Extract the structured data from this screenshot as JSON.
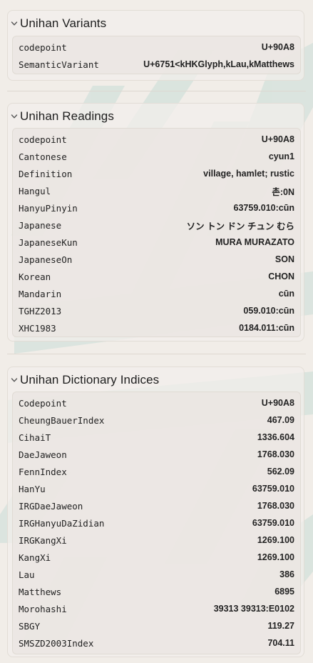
{
  "variants": {
    "title": "Unihan Variants",
    "rows": [
      {
        "key": "codepoint",
        "value": "U+90A8"
      },
      {
        "key": "SemanticVariant",
        "value": "U+6751<kHKGlyph,kLau,kMatthews"
      }
    ]
  },
  "readings": {
    "title": "Unihan Readings",
    "rows": [
      {
        "key": "codepoint",
        "value": "U+90A8"
      },
      {
        "key": "Cantonese",
        "value": "cyun1"
      },
      {
        "key": "Definition",
        "value": "village, hamlet; rustic"
      },
      {
        "key": "Hangul",
        "value": "촌:0N"
      },
      {
        "key": "HanyuPinyin",
        "value": "63759.010:cūn"
      },
      {
        "key": "Japanese",
        "value": "ソン トン ドン チュン むら"
      },
      {
        "key": "JapaneseKun",
        "value": "MURA MURAZATO"
      },
      {
        "key": "JapaneseOn",
        "value": "SON"
      },
      {
        "key": "Korean",
        "value": "CHON"
      },
      {
        "key": "Mandarin",
        "value": "cūn"
      },
      {
        "key": "TGHZ2013",
        "value": "059.010:cūn"
      },
      {
        "key": "XHC1983",
        "value": "0184.011:cūn"
      }
    ]
  },
  "indices": {
    "title": "Unihan Dictionary Indices",
    "rows": [
      {
        "key": "Codepoint",
        "value": "U+90A8"
      },
      {
        "key": "CheungBauerIndex",
        "value": "467.09"
      },
      {
        "key": "CihaiT",
        "value": "1336.604"
      },
      {
        "key": "DaeJaweon",
        "value": "1768.030"
      },
      {
        "key": "FennIndex",
        "value": "562.09"
      },
      {
        "key": "HanYu",
        "value": "63759.010"
      },
      {
        "key": "IRGDaeJaweon",
        "value": "1768.030"
      },
      {
        "key": "IRGHanyuDaZidian",
        "value": "63759.010"
      },
      {
        "key": "IRGKangXi",
        "value": "1269.100"
      },
      {
        "key": "KangXi",
        "value": "1269.100"
      },
      {
        "key": "Lau",
        "value": "386"
      },
      {
        "key": "Matthews",
        "value": "6895"
      },
      {
        "key": "Morohashi",
        "value": "39313 39313:E0102"
      },
      {
        "key": "SBGY",
        "value": "119.27"
      },
      {
        "key": "SMSZD2003Index",
        "value": "704.11"
      }
    ]
  },
  "icons": {
    "chevron": "chevron-down-icon"
  },
  "colors": {
    "background": "#f1ede8",
    "watermark": "#c7dcd6"
  }
}
